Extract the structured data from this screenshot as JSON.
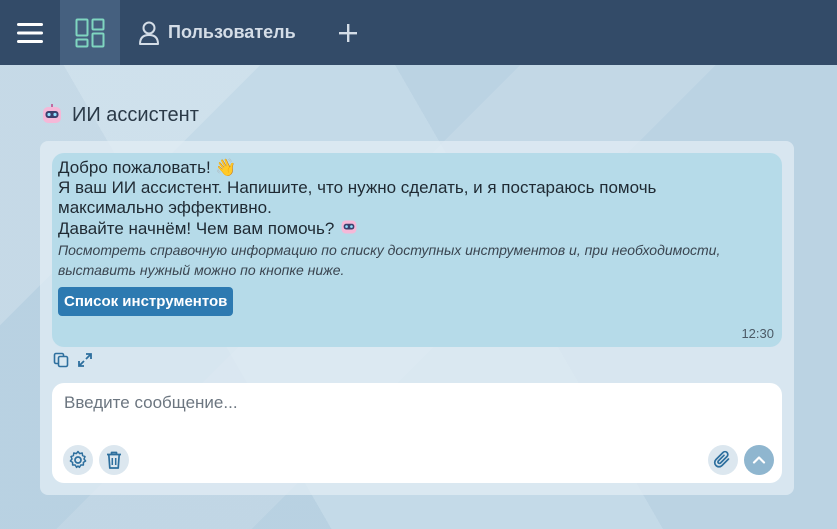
{
  "topbar": {
    "user_label": "Пользователь"
  },
  "panel": {
    "title": "ИИ ассистент"
  },
  "message": {
    "line1": "Добро пожаловать! 👋",
    "line2": "Я ваш ИИ ассистент. Напишите, что нужно сделать, и я постараюсь помочь",
    "line3": "максимально эффективно.",
    "line4": "Давайте начнём! Чем вам помочь?",
    "note": "Посмотреть справочную информацию по списку доступных инструментов и, при необходимости, выставить нужный можно по кнопке ниже.",
    "tools_button": "Список инструментов",
    "time": "12:30"
  },
  "composer": {
    "placeholder": "Введите сообщение..."
  },
  "colors": {
    "topbar": "#334b68",
    "accent": "#2d7ab1",
    "bubble": "#b6dbe9"
  }
}
